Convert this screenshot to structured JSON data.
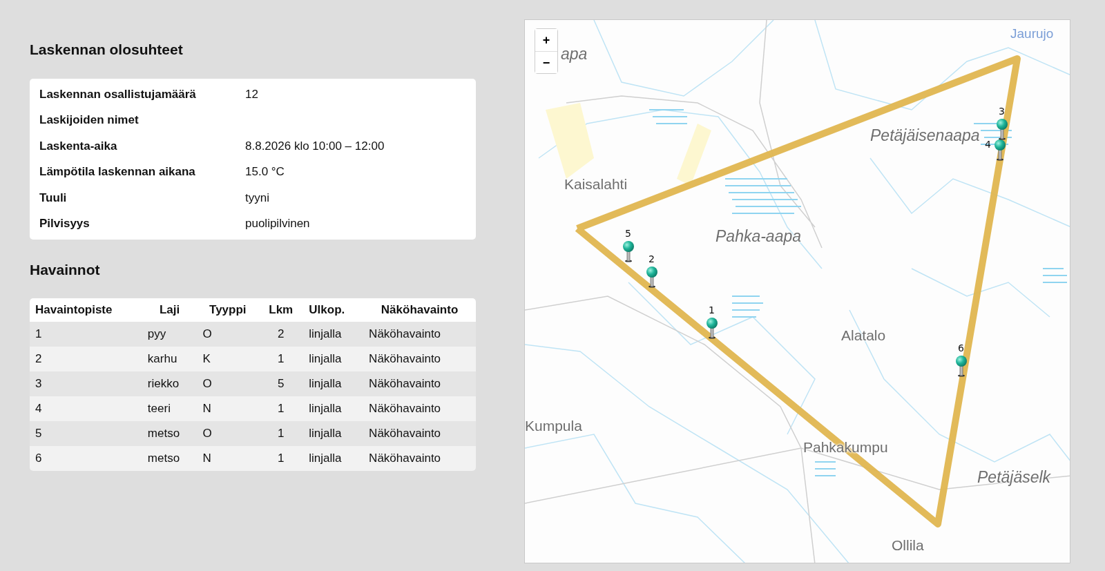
{
  "conditions": {
    "title": "Laskennan olosuhteet",
    "rows": [
      {
        "label": "Laskennan osallistujamäärä",
        "value": "12"
      },
      {
        "label": "Laskijoiden nimet"
      },
      {
        "label": "Laskenta-aika",
        "value": "8.8.2026 klo 10:00 – 12:00"
      },
      {
        "label": "Lämpötila laskennan aikana",
        "value": "15.0 °C"
      },
      {
        "label": "Tuuli",
        "value": "tyyni"
      },
      {
        "label": "Pilvisyys",
        "value": "puolipilvinen"
      }
    ]
  },
  "observations": {
    "title": "Havainnot",
    "columns": [
      "Havaintopiste",
      "Laji",
      "Tyyppi",
      "Lkm",
      "Ulkop.",
      "Näköhavainto"
    ],
    "rows": [
      [
        "1",
        "pyy",
        "O",
        "2",
        "linjalla",
        "Näköhavainto"
      ],
      [
        "2",
        "karhu",
        "K",
        "1",
        "linjalla",
        "Näköhavainto"
      ],
      [
        "3",
        "riekko",
        "O",
        "5",
        "linjalla",
        "Näköhavainto"
      ],
      [
        "4",
        "teeri",
        "N",
        "1",
        "linjalla",
        "Näköhavainto"
      ],
      [
        "5",
        "metso",
        "O",
        "1",
        "linjalla",
        "Näköhavainto"
      ],
      [
        "6",
        "metso",
        "N",
        "1",
        "linjalla",
        "Näköhavainto"
      ]
    ]
  },
  "map": {
    "zoom_in": "+",
    "zoom_out": "−",
    "places": [
      {
        "name": "Jaurujo",
        "kind": "water"
      },
      {
        "name": "apa",
        "kind": "area"
      },
      {
        "name": "Kaisalahti",
        "kind": "village"
      },
      {
        "name": "Pahka-aapa",
        "kind": "area"
      },
      {
        "name": "Petäjäisenaapa",
        "kind": "area"
      },
      {
        "name": "Alatalo",
        "kind": "village"
      },
      {
        "name": "Kumpula",
        "kind": "village"
      },
      {
        "name": "Pahkakumpu",
        "kind": "village"
      },
      {
        "name": "Petäjäselk",
        "kind": "area"
      },
      {
        "name": "Ollila",
        "kind": "village"
      }
    ],
    "pins": [
      "5",
      "2",
      "1",
      "4",
      "3",
      "6"
    ]
  }
}
